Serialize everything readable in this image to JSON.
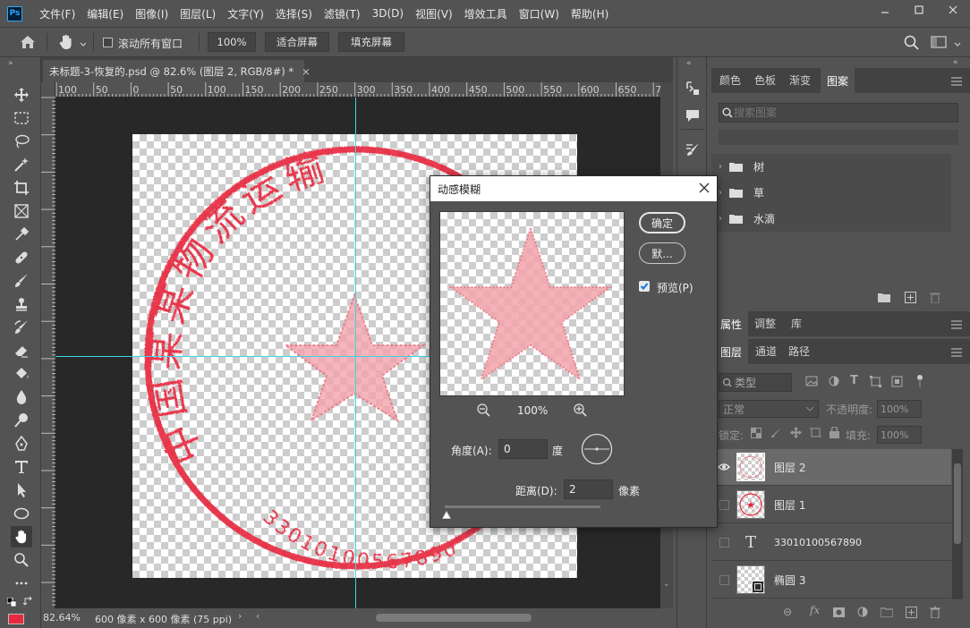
{
  "app": {
    "logo": "Ps"
  },
  "menu": [
    "文件(F)",
    "编辑(E)",
    "图像(I)",
    "图层(L)",
    "文字(Y)",
    "选择(S)",
    "滤镜(T)",
    "3D(D)",
    "视图(V)",
    "增效工具",
    "窗口(W)",
    "帮助(H)"
  ],
  "options": {
    "scroll_all_label": "滚动所有窗口",
    "zoom_value": "100%",
    "fit_screen_label": "适合屏幕",
    "fill_screen_label": "填充屏幕"
  },
  "document": {
    "tab_title": "未标题-3-恢复的.psd @ 82.6% (图层 2, RGB/8#) *",
    "close_glyph": "×"
  },
  "ruler": {
    "ticks": [
      "100",
      "50",
      "0",
      "50",
      "100",
      "150",
      "200",
      "250",
      "300",
      "350",
      "400",
      "450",
      "500",
      "550",
      "600",
      "650",
      "7"
    ]
  },
  "stamp": {
    "top_text": "中国某某物流运输",
    "bottom_text": "33010100567890",
    "color": "#e8283c"
  },
  "status": {
    "zoom": "82.64%",
    "doc_info": "600 像素 x 600 像素 (75 ppi)"
  },
  "dialog": {
    "title": "动感模糊",
    "ok_label": "确定",
    "default_label": "默...",
    "preview_label": "预览(P)",
    "preview_checked": true,
    "zoom_value": "100%",
    "angle_label": "角度(A):",
    "angle_value": "0",
    "angle_unit": "度",
    "distance_label": "距离(D):",
    "distance_value": "2",
    "distance_unit": "像素"
  },
  "swatch_panel": {
    "tabs": [
      "颜色",
      "色板",
      "渐变",
      "图案"
    ],
    "active_tab": "图案",
    "search_placeholder": "搜索图案",
    "folders": [
      "树",
      "草",
      "水滴"
    ]
  },
  "properties_panel": {
    "tabs": [
      "属性",
      "调整",
      "库"
    ]
  },
  "layers_panel": {
    "tabs": [
      "图层",
      "通道",
      "路径"
    ],
    "filter_label": "类型",
    "blend_mode": "正常",
    "opacity_label": "不透明度:",
    "opacity_value": "100%",
    "lock_label": "锁定:",
    "fill_label": "填充:",
    "fill_value": "100%",
    "layers": [
      {
        "name": "图层 2",
        "visible": true,
        "selected": true,
        "kind": "pixel"
      },
      {
        "name": "图层 1",
        "visible": false,
        "selected": false,
        "kind": "pixel"
      },
      {
        "name": "33010100567890",
        "visible": false,
        "selected": false,
        "kind": "text"
      },
      {
        "name": "椭圆 3",
        "visible": false,
        "selected": false,
        "kind": "shape"
      }
    ]
  },
  "colors": {
    "foreground": "#e8283c",
    "guide": "#38d6e6",
    "accent": "#31a8ff"
  }
}
